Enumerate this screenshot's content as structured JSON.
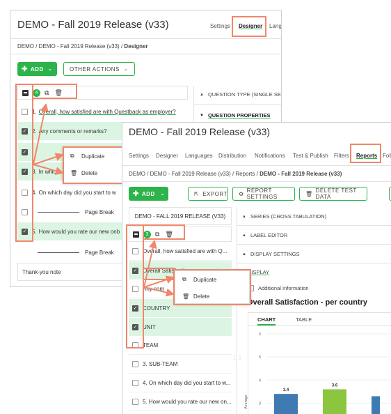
{
  "back_window": {
    "title": "DEMO - Fall 2019 Release (v33)",
    "nav": [
      "Settings",
      "Designer",
      "Lang"
    ],
    "breadcrumb": {
      "part1": "DEMO",
      "part2": "DEMO - Fall 2019 Release (v33)",
      "current": "Designer"
    },
    "add_label": "ADD",
    "other_actions_label": "OTHER ACTIONS",
    "selected_count": "4",
    "questions": [
      {
        "num": "1.",
        "text": "Overall, how satisfied are with Questback as employer?",
        "checked": false
      },
      {
        "num": "2.",
        "text": "Any comments or remarks?",
        "checked": true
      },
      {
        "num": "",
        "text": "",
        "checked": true
      },
      {
        "num": "3.",
        "text": "In which",
        "checked": true
      },
      {
        "num": "4.",
        "text": "On which day did you start to w",
        "checked": false
      },
      {
        "num": "",
        "text": "Page Break",
        "checked": false
      },
      {
        "num": "5.",
        "text": "How would you rate our new onb",
        "checked": true
      },
      {
        "num": "",
        "text": "Page Break",
        "checked": false
      }
    ],
    "thank_you": "Thank-you note",
    "panel_sections": [
      "QUESTION TYPE (SINGLE SE",
      "QUESTION PROPERTIES"
    ],
    "menu": [
      "Duplicate",
      "Delete"
    ]
  },
  "front_window": {
    "title": "DEMO - Fall 2019 Release (v33)",
    "nav": [
      "Settings",
      "Designer",
      "Languages",
      "Distribution",
      "Notifications",
      "Test & Publish",
      "Filters",
      "Reports",
      "Foll"
    ],
    "breadcrumb": {
      "part1": "DEMO",
      "part2": "DEMO - Fall 2019 Release (v33)",
      "part3": "Reports",
      "current": "DEMO - Fall 2019 Release (v33)"
    },
    "add_label": "ADD",
    "toolbar": {
      "export": "EXPORT",
      "report_settings": "REPORT SETTINGS",
      "delete_test_data": "DELETE TEST DATA"
    },
    "survey_header": "DEMO - FALL 2019 RELEASE (V33)",
    "selected_count": "3",
    "questions": [
      {
        "text": "Overall, how satisfied are with Q...",
        "checked": false
      },
      {
        "text": "Overall Satisfaction - per country",
        "checked": true
      },
      {
        "text": "Any com",
        "checked": false
      },
      {
        "text": "COUNTRY",
        "checked": true
      },
      {
        "text": "UNIT",
        "checked": true
      },
      {
        "text": "TEAM",
        "checked": false
      },
      {
        "text": "3.  SUB-TEAM",
        "checked": false
      },
      {
        "text": "4.  On which day did you start to w...",
        "checked": false
      },
      {
        "text": "5.  How would you rate our new on...",
        "checked": false
      }
    ],
    "sections": [
      "SERIES (CROSS TABULATION)",
      "LABEL EDITOR",
      "DISPLAY SETTINGS"
    ],
    "display_label": "DISPLAY",
    "additional_info": "Additional Information",
    "chart_title": "Overall Satisfaction - per country",
    "tabs": [
      "CHART",
      "TABLE"
    ],
    "menu": [
      "Duplicate",
      "Delete"
    ]
  },
  "chart_data": {
    "type": "bar",
    "title": "Overall Satisfaction - per country",
    "ylabel": "Average",
    "yticks": [
      "6",
      "5",
      "4",
      "3"
    ],
    "ylim": [
      2.5,
      6
    ],
    "categories": [
      "",
      "",
      ""
    ],
    "values": [
      3.4,
      3.6,
      null
    ],
    "labels": [
      "3.4",
      "3.6",
      ""
    ],
    "colors": [
      "#3e7bb3",
      "#8cc63f",
      "#3e7bb3"
    ]
  },
  "colors": {
    "accent": "#2cb34a",
    "highlight": "#f0876a",
    "selected_row": "#dcf5e3"
  }
}
